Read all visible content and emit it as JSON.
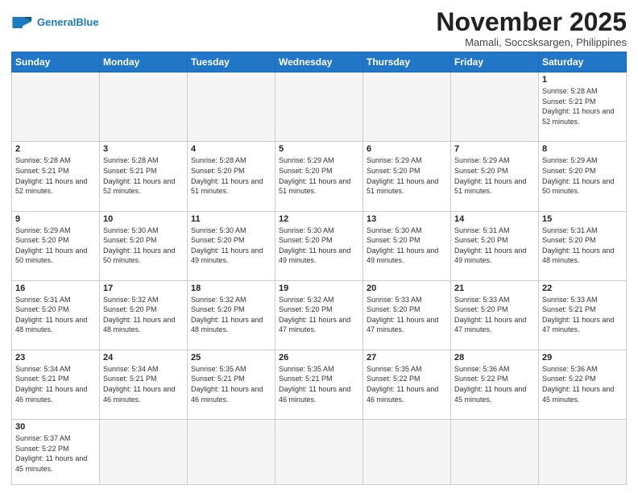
{
  "header": {
    "logo_general": "General",
    "logo_blue": "Blue",
    "month_title": "November 2025",
    "location": "Mamali, Soccsksargen, Philippines"
  },
  "weekdays": [
    "Sunday",
    "Monday",
    "Tuesday",
    "Wednesday",
    "Thursday",
    "Friday",
    "Saturday"
  ],
  "weeks": [
    [
      {
        "day": "",
        "sunrise": "",
        "sunset": "",
        "daylight": ""
      },
      {
        "day": "",
        "sunrise": "",
        "sunset": "",
        "daylight": ""
      },
      {
        "day": "",
        "sunrise": "",
        "sunset": "",
        "daylight": ""
      },
      {
        "day": "",
        "sunrise": "",
        "sunset": "",
        "daylight": ""
      },
      {
        "day": "",
        "sunrise": "",
        "sunset": "",
        "daylight": ""
      },
      {
        "day": "",
        "sunrise": "",
        "sunset": "",
        "daylight": ""
      },
      {
        "day": "1",
        "sunrise": "Sunrise: 5:28 AM",
        "sunset": "Sunset: 5:21 PM",
        "daylight": "Daylight: 11 hours and 52 minutes."
      }
    ],
    [
      {
        "day": "2",
        "sunrise": "Sunrise: 5:28 AM",
        "sunset": "Sunset: 5:21 PM",
        "daylight": "Daylight: 11 hours and 52 minutes."
      },
      {
        "day": "3",
        "sunrise": "Sunrise: 5:28 AM",
        "sunset": "Sunset: 5:21 PM",
        "daylight": "Daylight: 11 hours and 52 minutes."
      },
      {
        "day": "4",
        "sunrise": "Sunrise: 5:28 AM",
        "sunset": "Sunset: 5:20 PM",
        "daylight": "Daylight: 11 hours and 51 minutes."
      },
      {
        "day": "5",
        "sunrise": "Sunrise: 5:29 AM",
        "sunset": "Sunset: 5:20 PM",
        "daylight": "Daylight: 11 hours and 51 minutes."
      },
      {
        "day": "6",
        "sunrise": "Sunrise: 5:29 AM",
        "sunset": "Sunset: 5:20 PM",
        "daylight": "Daylight: 11 hours and 51 minutes."
      },
      {
        "day": "7",
        "sunrise": "Sunrise: 5:29 AM",
        "sunset": "Sunset: 5:20 PM",
        "daylight": "Daylight: 11 hours and 51 minutes."
      },
      {
        "day": "8",
        "sunrise": "Sunrise: 5:29 AM",
        "sunset": "Sunset: 5:20 PM",
        "daylight": "Daylight: 11 hours and 50 minutes."
      }
    ],
    [
      {
        "day": "9",
        "sunrise": "Sunrise: 5:29 AM",
        "sunset": "Sunset: 5:20 PM",
        "daylight": "Daylight: 11 hours and 50 minutes."
      },
      {
        "day": "10",
        "sunrise": "Sunrise: 5:30 AM",
        "sunset": "Sunset: 5:20 PM",
        "daylight": "Daylight: 11 hours and 50 minutes."
      },
      {
        "day": "11",
        "sunrise": "Sunrise: 5:30 AM",
        "sunset": "Sunset: 5:20 PM",
        "daylight": "Daylight: 11 hours and 49 minutes."
      },
      {
        "day": "12",
        "sunrise": "Sunrise: 5:30 AM",
        "sunset": "Sunset: 5:20 PM",
        "daylight": "Daylight: 11 hours and 49 minutes."
      },
      {
        "day": "13",
        "sunrise": "Sunrise: 5:30 AM",
        "sunset": "Sunset: 5:20 PM",
        "daylight": "Daylight: 11 hours and 49 minutes."
      },
      {
        "day": "14",
        "sunrise": "Sunrise: 5:31 AM",
        "sunset": "Sunset: 5:20 PM",
        "daylight": "Daylight: 11 hours and 49 minutes."
      },
      {
        "day": "15",
        "sunrise": "Sunrise: 5:31 AM",
        "sunset": "Sunset: 5:20 PM",
        "daylight": "Daylight: 11 hours and 48 minutes."
      }
    ],
    [
      {
        "day": "16",
        "sunrise": "Sunrise: 5:31 AM",
        "sunset": "Sunset: 5:20 PM",
        "daylight": "Daylight: 11 hours and 48 minutes."
      },
      {
        "day": "17",
        "sunrise": "Sunrise: 5:32 AM",
        "sunset": "Sunset: 5:20 PM",
        "daylight": "Daylight: 11 hours and 48 minutes."
      },
      {
        "day": "18",
        "sunrise": "Sunrise: 5:32 AM",
        "sunset": "Sunset: 5:20 PM",
        "daylight": "Daylight: 11 hours and 48 minutes."
      },
      {
        "day": "19",
        "sunrise": "Sunrise: 5:32 AM",
        "sunset": "Sunset: 5:20 PM",
        "daylight": "Daylight: 11 hours and 47 minutes."
      },
      {
        "day": "20",
        "sunrise": "Sunrise: 5:33 AM",
        "sunset": "Sunset: 5:20 PM",
        "daylight": "Daylight: 11 hours and 47 minutes."
      },
      {
        "day": "21",
        "sunrise": "Sunrise: 5:33 AM",
        "sunset": "Sunset: 5:20 PM",
        "daylight": "Daylight: 11 hours and 47 minutes."
      },
      {
        "day": "22",
        "sunrise": "Sunrise: 5:33 AM",
        "sunset": "Sunset: 5:21 PM",
        "daylight": "Daylight: 11 hours and 47 minutes."
      }
    ],
    [
      {
        "day": "23",
        "sunrise": "Sunrise: 5:34 AM",
        "sunset": "Sunset: 5:21 PM",
        "daylight": "Daylight: 11 hours and 46 minutes."
      },
      {
        "day": "24",
        "sunrise": "Sunrise: 5:34 AM",
        "sunset": "Sunset: 5:21 PM",
        "daylight": "Daylight: 11 hours and 46 minutes."
      },
      {
        "day": "25",
        "sunrise": "Sunrise: 5:35 AM",
        "sunset": "Sunset: 5:21 PM",
        "daylight": "Daylight: 11 hours and 46 minutes."
      },
      {
        "day": "26",
        "sunrise": "Sunrise: 5:35 AM",
        "sunset": "Sunset: 5:21 PM",
        "daylight": "Daylight: 11 hours and 46 minutes."
      },
      {
        "day": "27",
        "sunrise": "Sunrise: 5:35 AM",
        "sunset": "Sunset: 5:22 PM",
        "daylight": "Daylight: 11 hours and 46 minutes."
      },
      {
        "day": "28",
        "sunrise": "Sunrise: 5:36 AM",
        "sunset": "Sunset: 5:22 PM",
        "daylight": "Daylight: 11 hours and 45 minutes."
      },
      {
        "day": "29",
        "sunrise": "Sunrise: 5:36 AM",
        "sunset": "Sunset: 5:22 PM",
        "daylight": "Daylight: 11 hours and 45 minutes."
      }
    ],
    [
      {
        "day": "30",
        "sunrise": "Sunrise: 5:37 AM",
        "sunset": "Sunset: 5:22 PM",
        "daylight": "Daylight: 11 hours and 45 minutes."
      },
      {
        "day": "",
        "sunrise": "",
        "sunset": "",
        "daylight": ""
      },
      {
        "day": "",
        "sunrise": "",
        "sunset": "",
        "daylight": ""
      },
      {
        "day": "",
        "sunrise": "",
        "sunset": "",
        "daylight": ""
      },
      {
        "day": "",
        "sunrise": "",
        "sunset": "",
        "daylight": ""
      },
      {
        "day": "",
        "sunrise": "",
        "sunset": "",
        "daylight": ""
      },
      {
        "day": "",
        "sunrise": "",
        "sunset": "",
        "daylight": ""
      }
    ]
  ]
}
